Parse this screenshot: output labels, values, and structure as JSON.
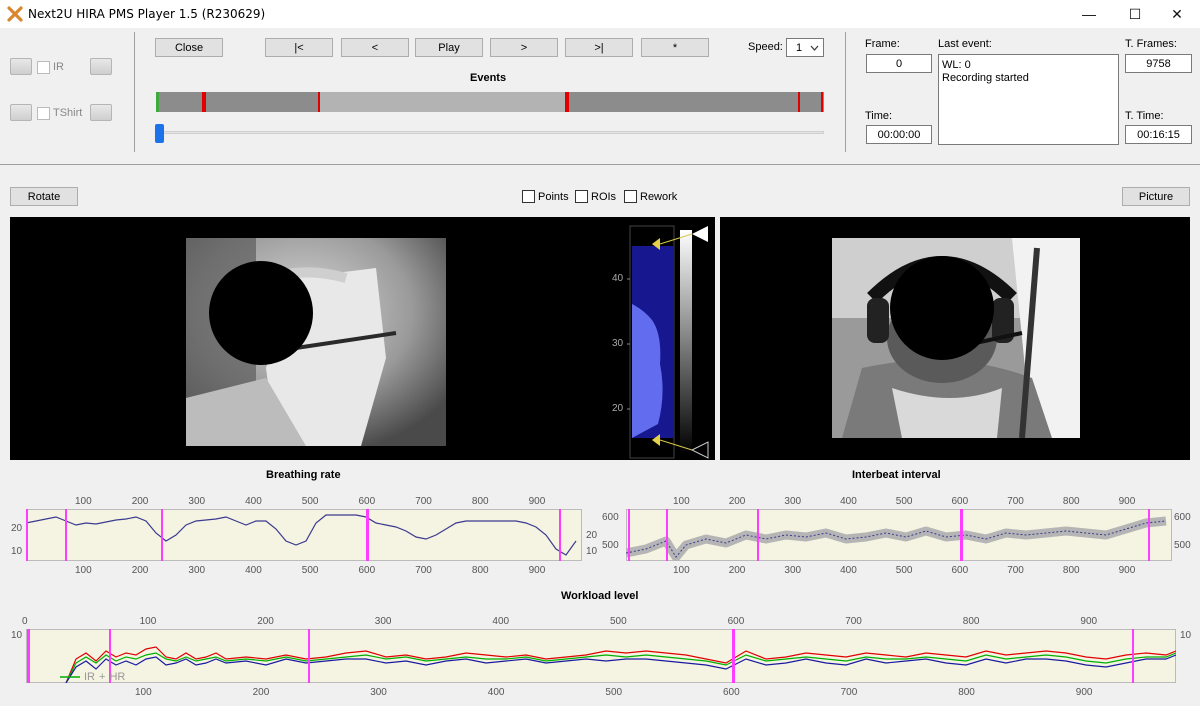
{
  "window": {
    "title": "Next2U HIRA PMS Player 1.5 (R230629)",
    "minimize": "—",
    "maximize": "☐",
    "close": "✕"
  },
  "left_controls": {
    "ir_label": "IR",
    "tshirt_label": "TShirt"
  },
  "toolbar": {
    "close_label": "Close",
    "first_label": "|<",
    "prev_label": "<",
    "play_label": "Play",
    "next_label": ">",
    "last_label": ">|",
    "star_label": "*",
    "speed_label": "Speed:",
    "speed_value": "1",
    "events_title": "Events"
  },
  "info": {
    "frame_label": "Frame:",
    "frame_value": "0",
    "time_label": "Time:",
    "time_value": "00:00:00",
    "last_event_label": "Last event:",
    "last_event_lines": [
      "WL: 0",
      "Recording started"
    ],
    "total_frames_label": "T. Frames:",
    "total_frames_value": "9758",
    "total_time_label": "T. Time:",
    "total_time_value": "00:16:15"
  },
  "view_controls": {
    "rotate_label": "Rotate",
    "points_label": "Points",
    "rois_label": "ROIs",
    "rework_label": "Rework",
    "picture_label": "Picture"
  },
  "colorbar": {
    "ticks": [
      "40",
      "30",
      "20"
    ]
  },
  "charts": {
    "breathing_title": "Breathing rate",
    "interbeat_title": "Interbeat interval",
    "workload_title": "Workload level",
    "x_ticks_br": [
      "100",
      "200",
      "300",
      "400",
      "500",
      "600",
      "700",
      "800",
      "900"
    ],
    "y_ticks_br": [
      "20",
      "10"
    ],
    "x_ticks_ibi": [
      "100",
      "200",
      "300",
      "400",
      "500",
      "600",
      "700",
      "800",
      "900"
    ],
    "y_ticks_ibi": [
      "600",
      "500"
    ],
    "x_ticks_wl_top": [
      "0",
      "100",
      "200",
      "300",
      "400",
      "500",
      "600",
      "700",
      "800",
      "900"
    ],
    "x_ticks_wl_bottom": [
      "100",
      "200",
      "300",
      "400",
      "500",
      "600",
      "700",
      "800",
      "900"
    ],
    "y_ticks_wl": [
      "10"
    ],
    "legend_ir": "IR",
    "legend_plus": "+",
    "legend_hr": "HR"
  },
  "colors": {
    "event_marker": "#ff3cff",
    "events_red": "#e00000",
    "series_blue": "#3030a0",
    "series_green": "#00b000",
    "series_red": "#e00000",
    "series_gray": "#b0b0b0",
    "plot_bg": "#f5f3e2",
    "slider_blue": "#1a73e8"
  }
}
